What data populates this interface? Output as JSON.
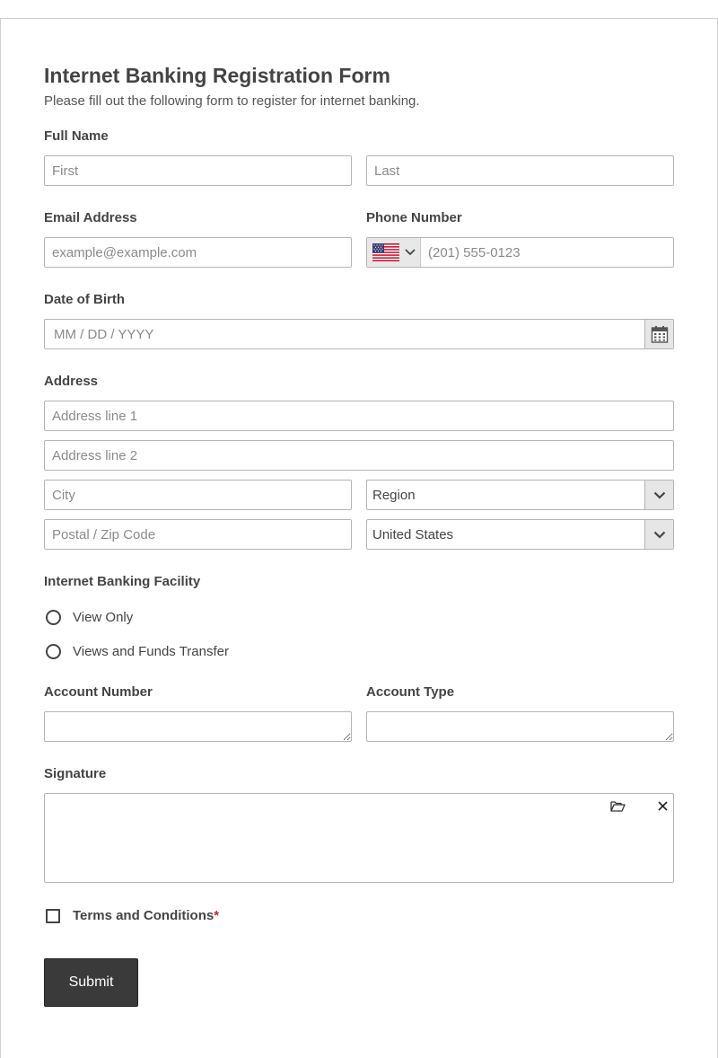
{
  "form": {
    "title": "Internet Banking Registration Form",
    "subtitle": "Please fill out the following form to register for internet banking."
  },
  "full_name": {
    "label": "Full Name",
    "first_placeholder": "First",
    "last_placeholder": "Last"
  },
  "email": {
    "label": "Email Address",
    "placeholder": "example@example.com"
  },
  "phone": {
    "label": "Phone Number",
    "placeholder": "(201) 555-0123",
    "country_flag_icon": "us-flag-icon"
  },
  "dob": {
    "label": "Date of Birth",
    "placeholder": "MM / DD / YYYY",
    "icon": "calendar-icon"
  },
  "address": {
    "label": "Address",
    "line1_placeholder": "Address line 1",
    "line2_placeholder": "Address line 2",
    "city_placeholder": "City",
    "region_value": "Region",
    "postal_placeholder": "Postal / Zip Code",
    "country_value": "United States"
  },
  "facility": {
    "label": "Internet Banking Facility",
    "options": [
      "View Only",
      "Views and Funds Transfer"
    ]
  },
  "account_number": {
    "label": "Account Number",
    "value": ""
  },
  "account_type": {
    "label": "Account Type",
    "value": ""
  },
  "signature": {
    "label": "Signature",
    "upload_icon": "folder-open-icon",
    "clear_icon": "close-icon"
  },
  "terms": {
    "label": "Terms and Conditions",
    "required_marker": "*"
  },
  "submit": {
    "label": "Submit"
  },
  "colors": {
    "text": "#444444",
    "border": "#b5b5b5",
    "submit_bg": "#3a3a3a",
    "required": "#c0282d"
  }
}
